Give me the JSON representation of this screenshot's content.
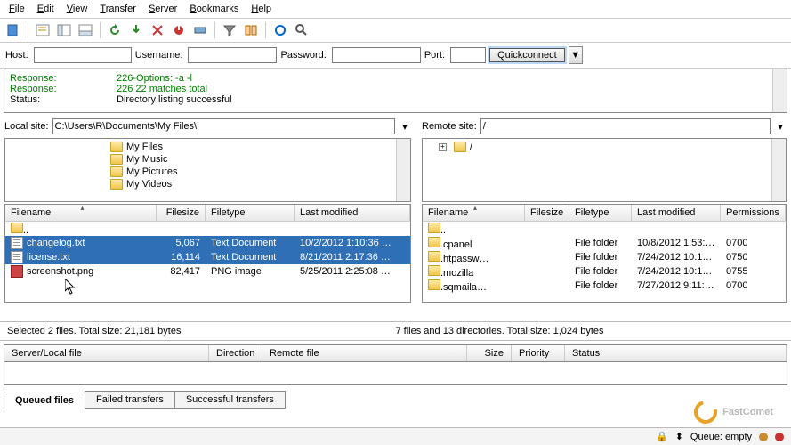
{
  "menu": [
    "File",
    "Edit",
    "View",
    "Transfer",
    "Server",
    "Bookmarks",
    "Help"
  ],
  "quickbar": {
    "host_label": "Host:",
    "user_label": "Username:",
    "pass_label": "Password:",
    "port_label": "Port:",
    "host": "",
    "user": "",
    "pass": "",
    "port": "",
    "connect": "Quickconnect"
  },
  "log": [
    {
      "label": "Response:",
      "msg": "226-Options: -a -l",
      "cls": ""
    },
    {
      "label": "Response:",
      "msg": "226 22 matches total",
      "cls": ""
    },
    {
      "label": "Status:",
      "msg": "Directory listing successful",
      "cls": "status"
    }
  ],
  "local": {
    "label": "Local site:",
    "path": "C:\\Users\\R\\Documents\\My Files\\",
    "tree": [
      "My Files",
      "My Music",
      "My Pictures",
      "My Videos"
    ],
    "cols": {
      "name": "Filename",
      "size": "Filesize",
      "type": "Filetype",
      "mod": "Last modified"
    },
    "rows": [
      {
        "name": "..",
        "icon": "folder",
        "size": "",
        "type": "",
        "mod": "",
        "sel": false
      },
      {
        "name": "changelog.txt",
        "icon": "txt",
        "size": "5,067",
        "type": "Text Document",
        "mod": "10/2/2012 1:10:36 …",
        "sel": true
      },
      {
        "name": "license.txt",
        "icon": "txt",
        "size": "16,114",
        "type": "Text Document",
        "mod": "8/21/2011 2:17:36 …",
        "sel": true
      },
      {
        "name": "screenshot.png",
        "icon": "png",
        "size": "82,417",
        "type": "PNG image",
        "mod": "5/25/2011 2:25:08 …",
        "sel": false
      }
    ],
    "status": "Selected 2 files. Total size: 21,181 bytes"
  },
  "remote": {
    "label": "Remote site:",
    "path": "/",
    "tree": [
      "/"
    ],
    "cols": {
      "name": "Filename",
      "size": "Filesize",
      "type": "Filetype",
      "mod": "Last modified",
      "perm": "Permissions"
    },
    "rows": [
      {
        "name": "..",
        "icon": "folder",
        "size": "",
        "type": "",
        "mod": "",
        "perm": ""
      },
      {
        "name": ".cpanel",
        "icon": "folder",
        "size": "",
        "type": "File folder",
        "mod": "10/8/2012 1:53:…",
        "perm": "0700"
      },
      {
        "name": ".htpassw…",
        "icon": "folder",
        "size": "",
        "type": "File folder",
        "mod": "7/24/2012 10:1…",
        "perm": "0750"
      },
      {
        "name": ".mozilla",
        "icon": "folder",
        "size": "",
        "type": "File folder",
        "mod": "7/24/2012 10:1…",
        "perm": "0755"
      },
      {
        "name": ".sqmaila…",
        "icon": "folder",
        "size": "",
        "type": "File folder",
        "mod": "7/27/2012 9:11:…",
        "perm": "0700"
      }
    ],
    "status": "7 files and 13 directories. Total size: 1,024 bytes"
  },
  "queue": {
    "cols": {
      "file": "Server/Local file",
      "dir": "Direction",
      "remote": "Remote file",
      "size": "Size",
      "prio": "Priority",
      "status": "Status"
    },
    "tabs": [
      "Queued files",
      "Failed transfers",
      "Successful transfers"
    ]
  },
  "footer": {
    "queue": "Queue: empty"
  },
  "watermark": "FastComet",
  "colors": {
    "led_red": "#c93030",
    "led_amber": "#c98b30"
  }
}
